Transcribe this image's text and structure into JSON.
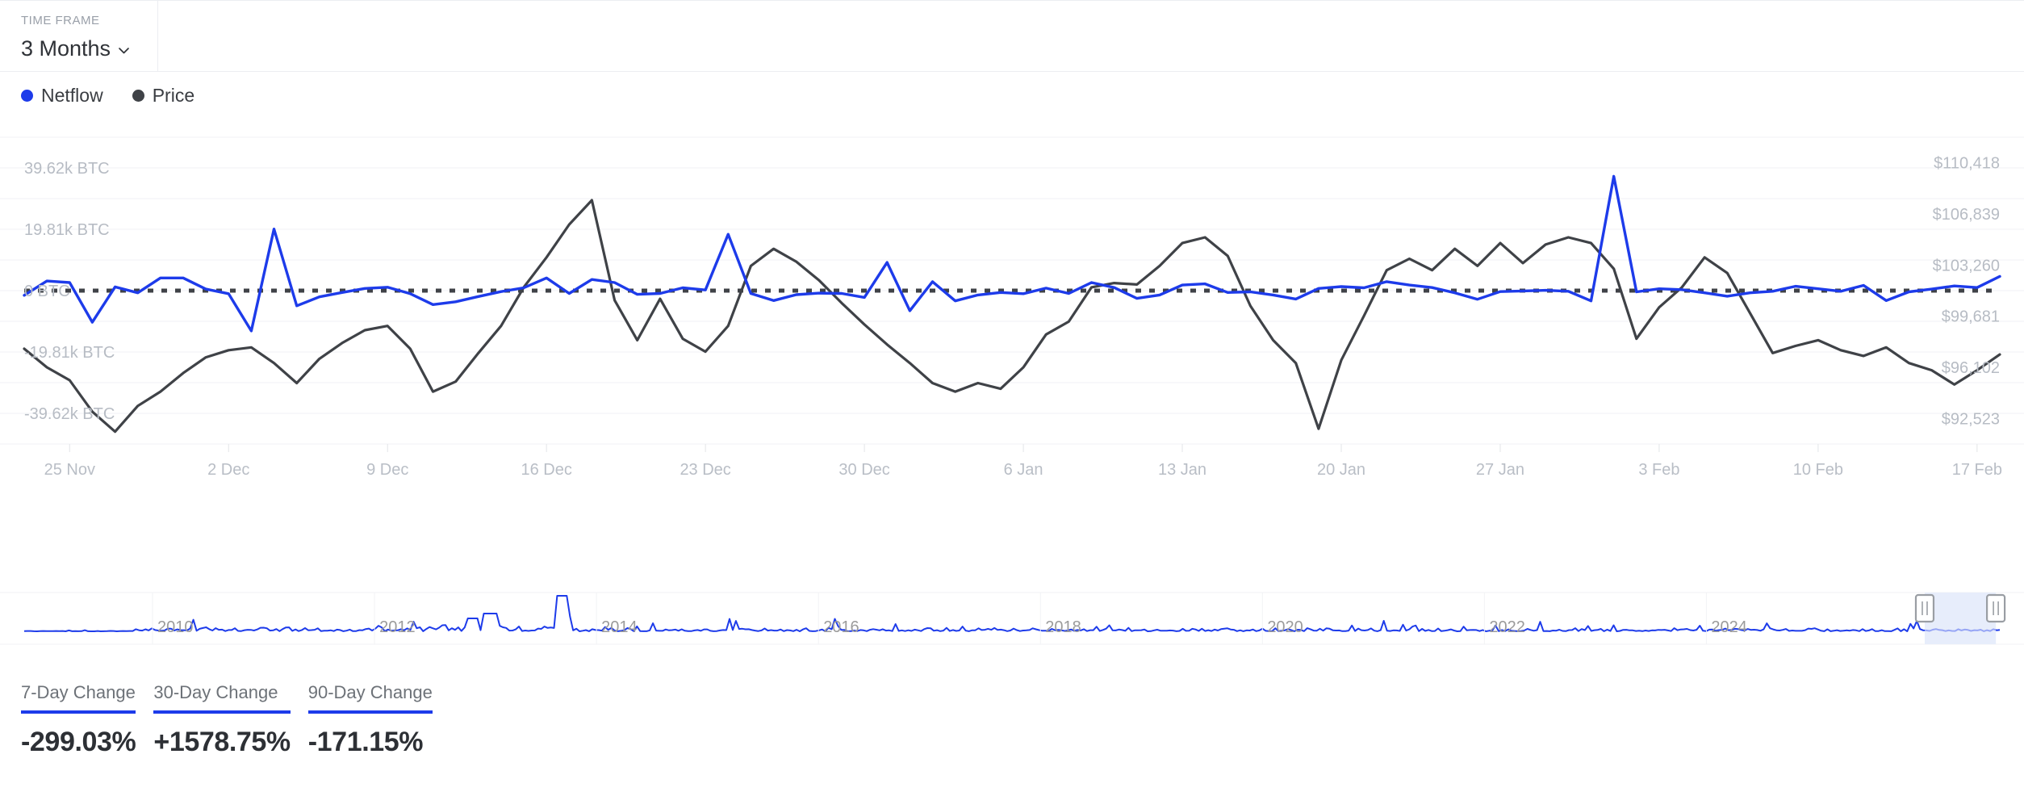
{
  "header": {
    "time_frame_label": "TIME FRAME",
    "time_frame_value": "3 Months",
    "chevron_icon": "chevron-down-icon"
  },
  "legend": {
    "items": [
      {
        "label": "Netflow",
        "color": "#1d3bea"
      },
      {
        "label": "Price",
        "color": "#3f4247"
      }
    ]
  },
  "colors": {
    "netflow": "#1d3bea",
    "price": "#3f4247",
    "zero_line": "#3f4247",
    "grid": "#f1f2f4",
    "axis_text": "#b7bcc4",
    "accent": "#1d3bea",
    "navigator_selection": "#e7edfb"
  },
  "stats": [
    {
      "label": "7-Day Change",
      "value": "-299.03%"
    },
    {
      "label": "30-Day Change",
      "value": "+1578.75%"
    },
    {
      "label": "90-Day Change",
      "value": "-171.15%"
    }
  ],
  "navigator": {
    "years": [
      "2010",
      "2012",
      "2014",
      "2016",
      "2018",
      "2020",
      "2022",
      "2024"
    ],
    "selection_start_pct": 96.2,
    "selection_end_pct": 99.8,
    "left_handle_icon": "drag-handle-icon",
    "right_handle_icon": "drag-handle-icon"
  },
  "chart_data": {
    "type": "line",
    "title": "",
    "xlabel": "",
    "grid": true,
    "legend_position": "top-left",
    "x_tick_labels": [
      "25 Nov",
      "2 Dec",
      "9 Dec",
      "16 Dec",
      "23 Dec",
      "30 Dec",
      "6 Jan",
      "13 Jan",
      "20 Jan",
      "27 Jan",
      "3 Feb",
      "10 Feb",
      "17 Feb"
    ],
    "x_tick_positions": [
      2,
      9,
      16,
      23,
      30,
      37,
      44,
      51,
      58,
      65,
      72,
      79,
      86
    ],
    "axes": {
      "left": {
        "label": "BTC",
        "tick_labels": [
          "39.62k BTC",
          "19.81k BTC",
          "0 BTC",
          "-19.81k BTC",
          "-39.62k BTC"
        ],
        "tick_values": [
          39620,
          19810,
          0,
          -19810,
          -39620
        ],
        "ylim": [
          -49525,
          49525
        ]
      },
      "right": {
        "label": "USD",
        "tick_labels": [
          "$110,418",
          "$106,839",
          "$103,260",
          "$99,681",
          "$96,102",
          "$92,523"
        ],
        "tick_values": [
          110418,
          106839,
          103260,
          99681,
          96102,
          92523
        ],
        "ylim": [
          90733,
          112208
        ]
      }
    },
    "zero_reference_line": 0,
    "series": [
      {
        "name": "Netflow",
        "axis": "left",
        "color": "#1d3bea",
        "unit": "BTC",
        "values": [
          -1500,
          3100,
          2600,
          -10200,
          1200,
          -700,
          4100,
          4100,
          500,
          -1000,
          -13000,
          19900,
          -4900,
          -2000,
          -600,
          700,
          1100,
          -1000,
          -4500,
          -3600,
          -1900,
          -300,
          900,
          4100,
          -900,
          3600,
          2600,
          -1200,
          -900,
          900,
          200,
          18200,
          -900,
          -3200,
          -1300,
          -800,
          -900,
          -2200,
          9100,
          -6500,
          2900,
          -3300,
          -1400,
          -600,
          -1000,
          800,
          -900,
          2600,
          1000,
          -2500,
          -1400,
          1800,
          2200,
          -600,
          -400,
          -1400,
          -2700,
          700,
          1300,
          900,
          2900,
          1800,
          1000,
          -700,
          -2800,
          -300,
          -100,
          100,
          -200,
          -3300,
          36900,
          -400,
          600,
          300,
          -700,
          -1800,
          -700,
          -200,
          1400,
          600,
          -200,
          1700,
          -3200,
          -400,
          500,
          1500,
          1000,
          4600
        ]
      },
      {
        "name": "Price",
        "axis": "right",
        "color": "#3f4247",
        "unit": "USD",
        "values": [
          97400,
          96100,
          95200,
          93000,
          91600,
          93400,
          94400,
          95700,
          96800,
          97300,
          97500,
          96400,
          95000,
          96700,
          97800,
          98700,
          99000,
          97400,
          94400,
          95100,
          97100,
          99000,
          101700,
          103800,
          106100,
          107800,
          100800,
          98000,
          100900,
          98100,
          97200,
          99000,
          103200,
          104400,
          103500,
          102200,
          100600,
          99100,
          97700,
          96400,
          95000,
          94400,
          95000,
          94600,
          96100,
          98400,
          99300,
          101700,
          102000,
          101900,
          103200,
          104800,
          105200,
          103900,
          100400,
          98000,
          96400,
          91800,
          96600,
          99700,
          102900,
          103700,
          102900,
          104400,
          103200,
          104800,
          103400,
          104700,
          105200,
          104800,
          103000,
          98100,
          100300,
          101700,
          103800,
          102700,
          99900,
          97100,
          97600,
          98000,
          97300,
          96900,
          97500,
          96400,
          95900,
          94900,
          95900,
          97000
        ]
      }
    ],
    "navigator_series": {
      "name": "Netflow (full history)",
      "color": "#1d3bea",
      "x_range": [
        "2009",
        "2025"
      ]
    }
  }
}
